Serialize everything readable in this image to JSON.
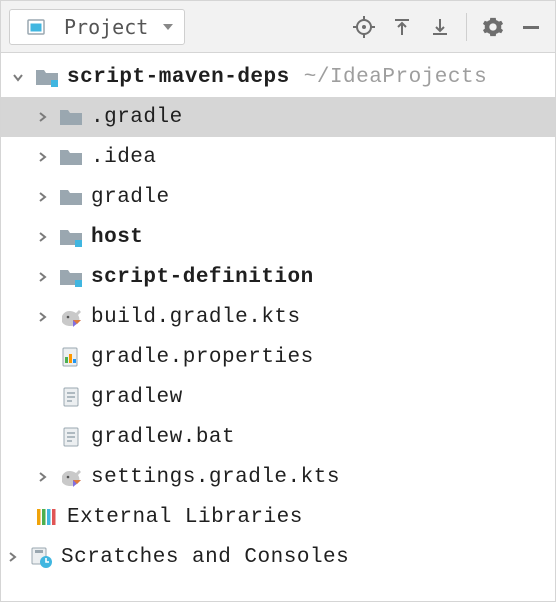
{
  "toolbar": {
    "view_label": "Project"
  },
  "tree": {
    "root": {
      "name": "script-maven-deps",
      "path_hint": "~/IdeaProjects"
    },
    "items": [
      {
        "label": ".gradle"
      },
      {
        "label": ".idea"
      },
      {
        "label": "gradle"
      },
      {
        "label": "host"
      },
      {
        "label": "script-definition"
      },
      {
        "label": "build.gradle.kts"
      },
      {
        "label": "gradle.properties"
      },
      {
        "label": "gradlew"
      },
      {
        "label": "gradlew.bat"
      },
      {
        "label": "settings.gradle.kts"
      }
    ],
    "external": "External Libraries",
    "scratches": "Scratches and Consoles"
  }
}
